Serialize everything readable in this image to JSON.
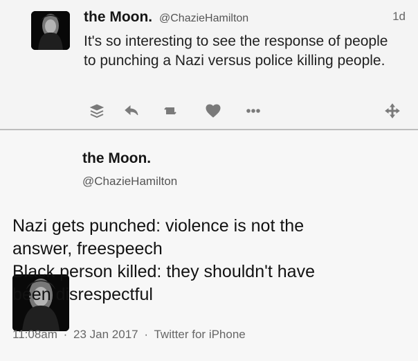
{
  "top_tweet": {
    "name": "the Moon.",
    "handle": "@ChazieHamilton",
    "time": "1d",
    "text": "It's so interesting to see the response of people to punching a Nazi versus police killing people.",
    "actions": [
      {
        "icon": "stack-icon"
      },
      {
        "icon": "reply-icon"
      },
      {
        "icon": "retweet-icon"
      },
      {
        "icon": "heart-icon"
      },
      {
        "icon": "more-icon"
      },
      {
        "icon": "move-icon"
      }
    ]
  },
  "bottom_tweet": {
    "name": "the Moon.",
    "handle": "@ChazieHamilton",
    "lines": [
      "Nazi gets punched: violence is not the",
      "answer, freespeech",
      "Black person killed: they shouldn't have",
      "been disrespectful"
    ],
    "time": "11:08am",
    "date": "23 Jan 2017",
    "source": "Twitter for iPhone",
    "separator": "·"
  },
  "colors": {
    "background": "#f3f3f3",
    "divider": "#bdbdbd",
    "text": "#1a1a1a",
    "muted": "#666666",
    "icon": "#7a7a7a"
  }
}
